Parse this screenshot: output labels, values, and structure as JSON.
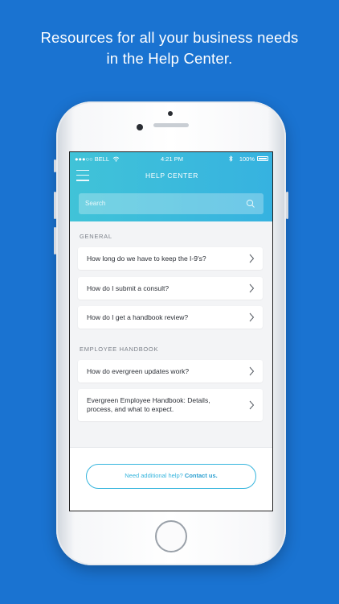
{
  "headline": {
    "line1": "Resources for all your business needs",
    "line2": "in the Help Center."
  },
  "status_bar": {
    "carrier": "●●●○○ BELL",
    "time": "4:21 PM",
    "battery": "100%"
  },
  "nav": {
    "title": "HELP CENTER"
  },
  "search": {
    "placeholder": "Search"
  },
  "sections": [
    {
      "label": "GENERAL",
      "items": [
        "How long do we have to keep the I-9's?",
        "How do I submit a consult?",
        "How do I get a handbook review?"
      ]
    },
    {
      "label": "EMPLOYEE HANDBOOK",
      "items": [
        "How do evergreen updates work?",
        "Evergreen Employee Handbook: Details, process, and what to expect."
      ]
    }
  ],
  "footer": {
    "help_text": "Need additional help?",
    "contact_link": "Contact us."
  },
  "colors": {
    "background": "#1a73d1",
    "header_gradient_start": "#40c3d8",
    "header_gradient_end": "#36b2e0",
    "accent": "#36b5dd"
  }
}
